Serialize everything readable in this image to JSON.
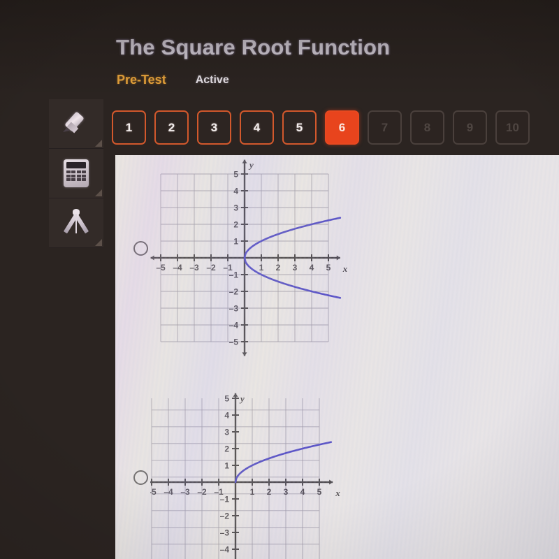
{
  "header": {
    "title": "The Square Root Function",
    "test_label": "Pre-Test",
    "status_label": "Active"
  },
  "question_nav": {
    "buttons": [
      {
        "label": "1",
        "state": "available"
      },
      {
        "label": "2",
        "state": "available"
      },
      {
        "label": "3",
        "state": "available"
      },
      {
        "label": "4",
        "state": "available"
      },
      {
        "label": "5",
        "state": "available"
      },
      {
        "label": "6",
        "state": "current"
      },
      {
        "label": "7",
        "state": "disabled"
      },
      {
        "label": "8",
        "state": "disabled"
      },
      {
        "label": "9",
        "state": "disabled"
      },
      {
        "label": "10",
        "state": "disabled"
      }
    ]
  },
  "toolbar": {
    "tools": [
      {
        "icon": "highlighter-icon",
        "name": "highlighter-tool"
      },
      {
        "icon": "calculator-icon",
        "name": "calculator-tool"
      },
      {
        "icon": "compass-icon",
        "name": "compass-tool"
      }
    ]
  },
  "answer_options": [
    {
      "id": "option-a",
      "selected": false
    },
    {
      "id": "option-b",
      "selected": false
    }
  ],
  "colors": {
    "background": "#2b2421",
    "panel": "#e8e4e8",
    "accent_orange": "#e8441d",
    "accent_outline": "#d2582c",
    "pretest_gold": "#f0a93c",
    "curve_blue": "#3a33c0",
    "axis_dark": "#2e2a30",
    "grid_line": "#8f8a9c"
  },
  "chart_data": [
    {
      "id": "option-a-graph",
      "type": "line",
      "title": "",
      "xlabel": "x",
      "ylabel": "y",
      "xlim": [
        -5.6,
        5.6
      ],
      "ylim": [
        -5.6,
        5.6
      ],
      "xticks": [
        -5,
        -4,
        -3,
        -2,
        -1,
        1,
        2,
        3,
        4,
        5
      ],
      "yticks": [
        -5,
        -4,
        -3,
        -2,
        -1,
        1,
        2,
        3,
        4,
        5
      ],
      "xtick_labels": [
        "-5",
        "-4",
        "-3",
        "-2",
        "-1",
        "1",
        "2",
        "3",
        "4",
        "5"
      ],
      "ytick_labels": [
        "-5",
        "-4",
        "-3",
        "-2",
        "-1",
        "1",
        "2",
        "3",
        "4",
        "5"
      ],
      "grid": true,
      "legend": "none",
      "series": [
        {
          "name": "x = y^2 upper branch",
          "color": "#3a33c0",
          "points": [
            [
              0,
              0
            ],
            [
              0.25,
              0.5
            ],
            [
              1,
              1
            ],
            [
              2.25,
              1.5
            ],
            [
              4,
              2
            ],
            [
              5.6,
              2.37
            ]
          ]
        },
        {
          "name": "x = y^2 lower branch",
          "color": "#3a33c0",
          "points": [
            [
              0,
              0
            ],
            [
              0.25,
              -0.5
            ],
            [
              1,
              -1
            ],
            [
              2.25,
              -1.5
            ],
            [
              4,
              -2
            ],
            [
              5.6,
              -2.37
            ]
          ]
        }
      ]
    },
    {
      "id": "option-b-graph",
      "type": "line",
      "title": "",
      "xlabel": "x",
      "ylabel": "y",
      "xlim": [
        -5.6,
        5.8
      ],
      "ylim": [
        -5.2,
        5.4
      ],
      "xticks": [
        -5,
        -4,
        -3,
        -2,
        -1,
        1,
        2,
        3,
        4,
        5
      ],
      "yticks": [
        -4,
        -3,
        -2,
        -1,
        1,
        2,
        3,
        4,
        5
      ],
      "xtick_labels": [
        "-5",
        "-4",
        "-3",
        "-2",
        "-1",
        "1",
        "2",
        "3",
        "4",
        "5"
      ],
      "ytick_labels": [
        "-4",
        "-3",
        "-2",
        "-1",
        "1",
        "2",
        "3",
        "4",
        "5"
      ],
      "grid": true,
      "legend": "none",
      "series": [
        {
          "name": "y = sqrt(x)",
          "color": "#3a33c0",
          "points": [
            [
              0,
              0
            ],
            [
              0.25,
              0.5
            ],
            [
              1,
              1
            ],
            [
              2.25,
              1.5
            ],
            [
              4,
              2
            ],
            [
              5.6,
              2.37
            ]
          ]
        }
      ]
    }
  ]
}
